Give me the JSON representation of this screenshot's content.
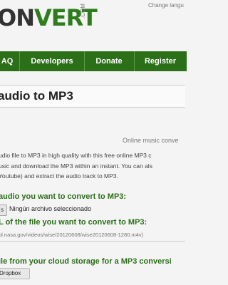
{
  "header": {
    "logo_text_left": "ON",
    "logo_text_right": "VERT",
    "logo_domain": ".COM",
    "change_language": "Change langu"
  },
  "nav": {
    "items": [
      {
        "label": "AQ"
      },
      {
        "label": "Developers"
      },
      {
        "label": "Donate"
      },
      {
        "label": "Register"
      }
    ]
  },
  "main": {
    "title": "audio to MP3",
    "subtitle": "Online music conve",
    "description_lines": [
      "udio file to MP3 in high quality with this free online MP3 c",
      "usic and download the MP3 within an instant. You can als",
      "Youtube) and extract the audio track to MP3."
    ],
    "upload_label": "audio you want to convert to MP3:",
    "file_button": "s",
    "file_status": "Ningún archivo seleccionado",
    "url_label": "L of the file you want to convert to MP3:",
    "url_placeholder": "pl.nasa.gov/videos/wise/20120608/wise20120608-1280.m4v)",
    "cloud_label": "ile from your cloud storage for a MP3 conversi",
    "dropbox_button": "Dropbox"
  },
  "colors": {
    "brand_green": "#2b6f19",
    "background": "#f4f4f4"
  }
}
